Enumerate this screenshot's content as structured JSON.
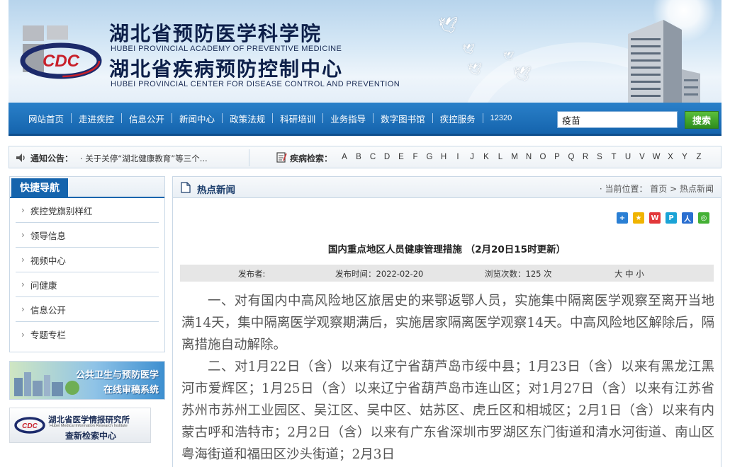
{
  "header": {
    "org_cn_1": "湖北省预防医学科学院",
    "org_en_1": "HUBEI PROVINCIAL ACADEMY OF PREVENTIVE MEDICINE",
    "org_cn_2": "湖北省疾病预防控制中心",
    "org_en_2": "HUBEI PROVINCIAL CENTER FOR DISEASE CONTROL AND PREVENTION",
    "logo_text": "CDC"
  },
  "nav": {
    "items": [
      "网站首页",
      "走进疾控",
      "信息公开",
      "新闻中心",
      "政策法规",
      "科研培训",
      "业务指导",
      "数字图书馆",
      "疾控服务",
      "12320"
    ],
    "search_value": "疫苗",
    "search_button": "搜索"
  },
  "notice": {
    "label": "通知公告：",
    "text": "· 关于关停“湖北健康教育”等三个..."
  },
  "disease_search": {
    "label": "疾病检索：",
    "letters": [
      "A",
      "B",
      "C",
      "D",
      "E",
      "F",
      "G",
      "H",
      "I",
      "J",
      "K",
      "L",
      "M",
      "N",
      "O",
      "P",
      "Q",
      "R",
      "S",
      "T",
      "U",
      "V",
      "W",
      "X",
      "Y",
      "Z"
    ]
  },
  "quicknav": {
    "title": "快捷导航",
    "items": [
      "疾控党旗别样红",
      "领导信息",
      "视频中心",
      "问健康",
      "信息公开",
      "专题专栏"
    ]
  },
  "promo1": {
    "line1": "公共卫生与预防医学",
    "line2": "在线审稿系统"
  },
  "promo2": {
    "line1": "湖北省医学情报研究所",
    "line2": "Hubei Medical Information Research Institute",
    "line3": "查新检索中心"
  },
  "main": {
    "section_title": "热点新闻",
    "breadcrumb": "· 当前位置： 首页 > 热点新闻",
    "article_title": "国内重点地区人员健康管理措施 （2月20日15时更新）",
    "meta": {
      "publisher": "发布者:",
      "date": "发布时间：2022-02-20",
      "views": "浏览次数：125 次",
      "font_size": "大 中 小"
    },
    "paragraphs": [
      "一、对有国内中高风险地区旅居史的来鄂返鄂人员，实施集中隔离医学观察至离开当地满14天，集中隔离医学观察期满后，实施居家隔离医学观察14天。中高风险地区解除后，隔离措施自动解除。",
      "二、对1月22日（含）以来有辽宁省葫芦岛市绥中县；1月23日（含）以来有黑龙江黑河市爱辉区；1月25日（含）以来辽宁省葫芦岛市连山区；对1月27日（含）以来有江苏省苏州市苏州工业园区、吴江区、吴中区、姑苏区、虎丘区和相城区；2月1日（含）以来有内蒙古呼和浩特市；2月2日（含）以来有广东省深圳市罗湖区东门街道和清水河街道、南山区粤海街道和福田区沙头街道；2月3日"
    ]
  }
}
